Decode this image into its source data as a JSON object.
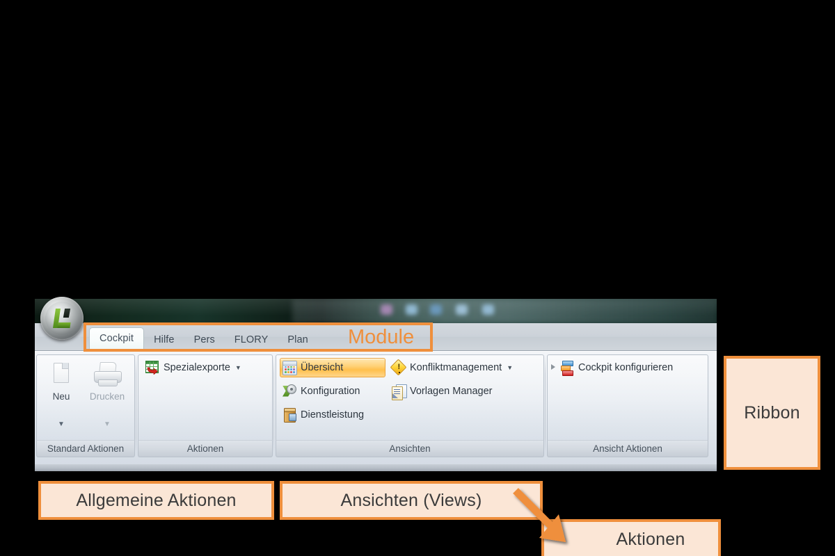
{
  "window": {
    "orb_icon": "app-orb-logo-icon",
    "quick_access_icons": [
      "qa-blob-violet",
      "qa-blob-blue-1",
      "qa-blob-blue-2",
      "qa-blob-blue-3",
      "qa-blob-blue-4"
    ],
    "quick_access_colors": [
      "#b48ec0",
      "#9cc6e4",
      "#6f9fc8",
      "#a9cce6",
      "#9ec6e3"
    ]
  },
  "tabs": [
    {
      "label": "Cockpit",
      "active": true
    },
    {
      "label": "Hilfe",
      "active": false
    },
    {
      "label": "Pers",
      "active": false
    },
    {
      "label": "FLORY",
      "active": false
    },
    {
      "label": "Plan",
      "active": false
    }
  ],
  "ribbon": {
    "groups": [
      {
        "name": "standard-aktionen",
        "label": "Standard Aktionen",
        "big_buttons": [
          {
            "label": "Neu",
            "icon": "new-document-icon",
            "disabled": false,
            "has_dropdown": true
          },
          {
            "label": "Drucken",
            "icon": "printer-icon",
            "disabled": true,
            "has_dropdown": true
          }
        ]
      },
      {
        "name": "aktionen",
        "label": "Aktionen",
        "items": [
          {
            "label": "Spezialexporte",
            "icon": "spreadsheet-export-icon",
            "has_dropdown": true,
            "selected": false
          }
        ]
      },
      {
        "name": "ansichten",
        "label": "Ansichten",
        "items": [
          {
            "label": "Übersicht",
            "icon": "calendar-overview-icon",
            "has_dropdown": false,
            "selected": true
          },
          {
            "label": "Konfliktmanagement",
            "icon": "warning-diamond-icon",
            "has_dropdown": true,
            "selected": false
          },
          {
            "label": "Konfiguration",
            "icon": "gear-arrow-icon",
            "has_dropdown": false,
            "selected": false
          },
          {
            "label": "Vorlagen Manager",
            "icon": "document-stack-icon",
            "has_dropdown": false,
            "selected": false
          },
          {
            "label": "Dienstleistung",
            "icon": "service-box-icon",
            "has_dropdown": false,
            "selected": false
          }
        ]
      },
      {
        "name": "ansicht-aktionen",
        "label": "Ansicht Aktionen",
        "items": [
          {
            "label": "Cockpit konfigurieren",
            "icon": "cockpit-configure-icon",
            "has_expander": true,
            "selected": false
          }
        ]
      }
    ]
  },
  "annotations": {
    "module_label": "Module",
    "ribbon_label": "Ribbon",
    "allgemeine_aktionen_label": "Allgemeine Aktionen",
    "ansichten_views_label": "Ansichten (Views)",
    "aktionen_label": "Aktionen",
    "accent_color": "#ef8f3c",
    "fill_color": "#fbe6d6",
    "text_color": "#3b3b3b"
  }
}
